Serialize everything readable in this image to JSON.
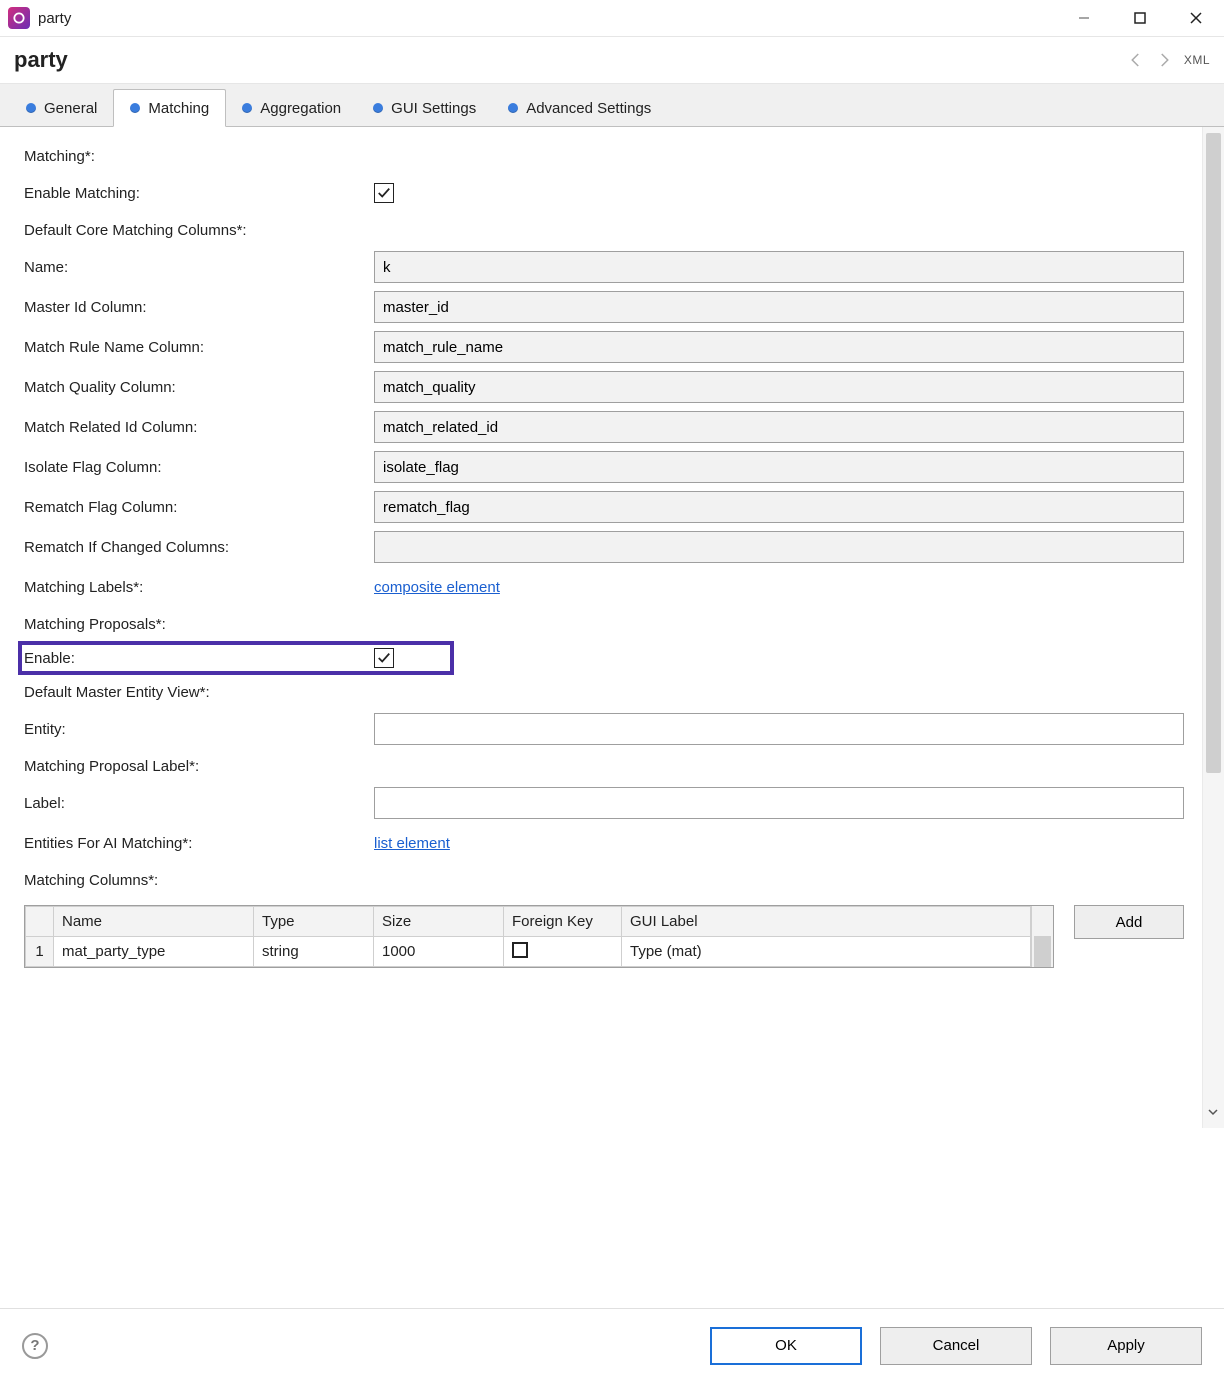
{
  "window": {
    "title": "party"
  },
  "header": {
    "title": "party",
    "xml_label": "XML"
  },
  "tabs": [
    {
      "id": "general",
      "label": "General"
    },
    {
      "id": "matching",
      "label": "Matching"
    },
    {
      "id": "aggregation",
      "label": "Aggregation"
    },
    {
      "id": "gui",
      "label": "GUI Settings"
    },
    {
      "id": "advanced",
      "label": "Advanced Settings"
    }
  ],
  "active_tab": "matching",
  "sections": {
    "matching_header": "Matching*:",
    "enable_matching_label": "Enable Matching:",
    "default_core_cols_label": "Default Core Matching Columns*:",
    "name_label": "Name:",
    "name_value": "k",
    "master_id_label": "Master Id Column:",
    "master_id_value": "master_id",
    "match_rule_label": "Match Rule Name Column:",
    "match_rule_value": "match_rule_name",
    "match_quality_label": "Match Quality Column:",
    "match_quality_value": "match_quality",
    "match_related_label": "Match Related Id Column:",
    "match_related_value": "match_related_id",
    "isolate_flag_label": "Isolate Flag Column:",
    "isolate_flag_value": "isolate_flag",
    "rematch_flag_label": "Rematch Flag Column:",
    "rematch_flag_value": "rematch_flag",
    "rematch_if_changed_label": "Rematch If Changed Columns:",
    "rematch_if_changed_value": "",
    "matching_labels_label": "Matching Labels*:",
    "matching_labels_link": "composite element",
    "matching_proposals_label": "Matching Proposals*:",
    "enable_label": "Enable:",
    "default_master_view_label": "Default Master Entity View*:",
    "entity_label": "Entity:",
    "entity_value": "",
    "proposal_label_header": "Matching Proposal Label*:",
    "label_label": "Label:",
    "label_value": "",
    "ai_matching_label": "Entities For AI Matching*:",
    "ai_matching_link": "list element",
    "matching_columns_label": "Matching Columns*:"
  },
  "table": {
    "headers": {
      "name": "Name",
      "type": "Type",
      "size": "Size",
      "fk": "Foreign Key",
      "gui": "GUI Label"
    },
    "rows": [
      {
        "num": "1",
        "name": "mat_party_type",
        "type": "string",
        "size": "1000",
        "fk": false,
        "gui": "Type (mat)"
      }
    ],
    "add_label": "Add"
  },
  "footer": {
    "ok": "OK",
    "cancel": "Cancel",
    "apply": "Apply"
  }
}
